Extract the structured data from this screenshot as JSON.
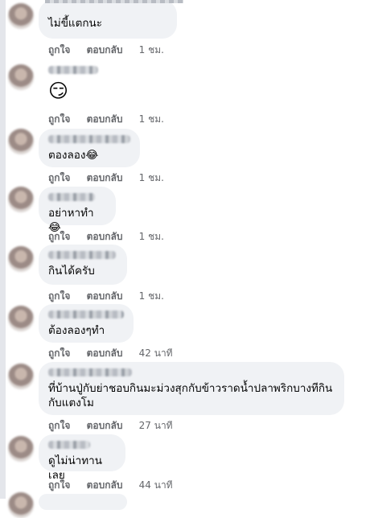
{
  "actions": {
    "like": "ถูกใจ",
    "reply": "ตอบกลับ"
  },
  "comments": [
    {
      "text": "ไม่ขี้แตกนะ",
      "time": "1 ชม."
    },
    {
      "text": "😏",
      "time": "1 ชม."
    },
    {
      "text": "ตองลอง😂",
      "time": "1 ชม."
    },
    {
      "text": "อย่าหาทำ😂",
      "time": "1 ชม."
    },
    {
      "text": "กินได้ครับ",
      "time": "1 ชม."
    },
    {
      "text": "ต้องลองๆทำ",
      "time": "42 นาที"
    },
    {
      "text": "ที่บ้านปู่กับย่าชอบกินมะม่วงสุกกับข้าวราดน้ำปลาพริกบางทีกินกับแตงโม",
      "time": "27 นาที"
    },
    {
      "text": "ดูไม่น่าทานเลย",
      "time": "44 นาที"
    }
  ]
}
